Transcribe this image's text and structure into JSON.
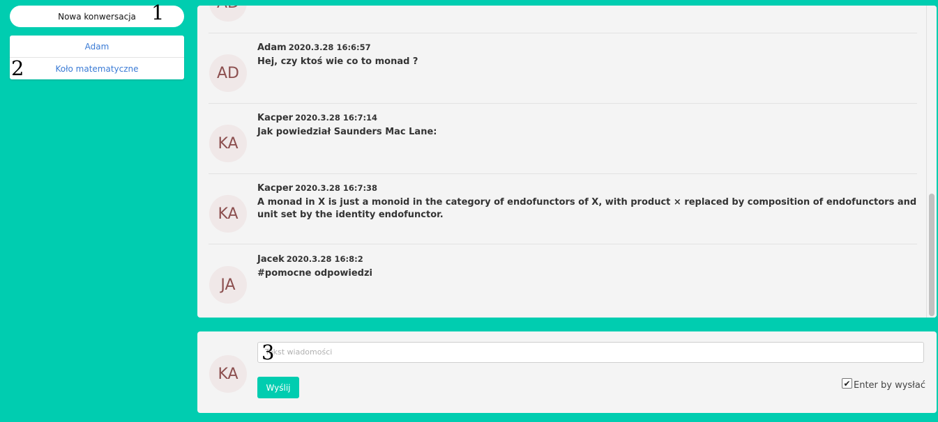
{
  "sidebar": {
    "new_conversation_label": "Nowa konwersacja",
    "conversations": [
      {
        "label": "Adam"
      },
      {
        "label": "Koło matematyczne"
      }
    ]
  },
  "markers": [
    "1",
    "2",
    "3"
  ],
  "messages": [
    {
      "initials": "AD",
      "author": "",
      "timestamp": "",
      "text": ""
    },
    {
      "initials": "AD",
      "author": "Adam",
      "timestamp": "2020.3.28 16:6:57",
      "text": "Hej, czy ktoś wie co to monad ?"
    },
    {
      "initials": "KA",
      "author": "Kacper",
      "timestamp": "2020.3.28 16:7:14",
      "text": "Jak powiedział Saunders Mac Lane:"
    },
    {
      "initials": "KA",
      "author": "Kacper",
      "timestamp": "2020.3.28 16:7:38",
      "text": "A monad in X is just a monoid in the category of endofunctors of X, with product × replaced by composition of endofunctors and unit set by the identity endofunctor."
    },
    {
      "initials": "JA",
      "author": "Jacek",
      "timestamp": "2020.3.28 16:8:2",
      "text": "#pomocne odpowiedzi"
    }
  ],
  "compose": {
    "avatar_initials": "KA",
    "placeholder": "Tekst wiadomości",
    "send_label": "Wyślij",
    "enter_to_send_label": "Enter by wysłać",
    "enter_to_send_checked": true
  },
  "colors": {
    "background": "#00cdb0",
    "link": "#3a7bd5",
    "avatar_bg": "#f0e8e8",
    "avatar_text": "#8c4f4f"
  }
}
